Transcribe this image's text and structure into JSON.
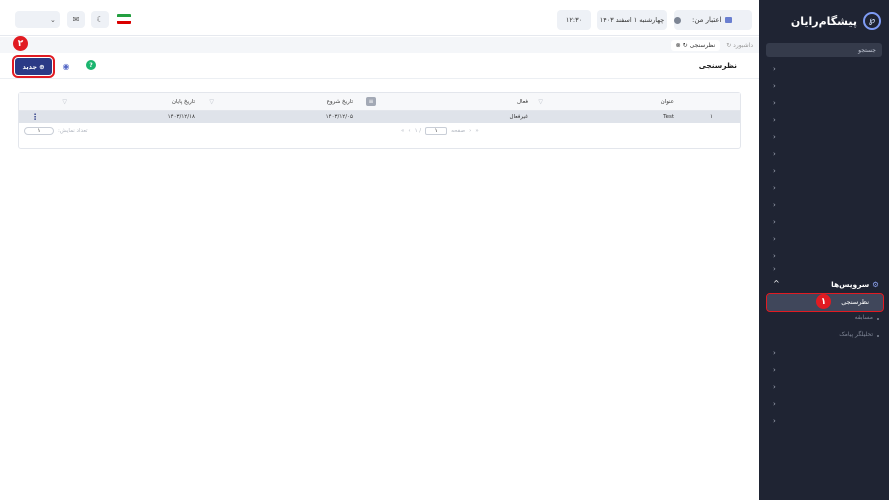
{
  "header": {
    "credit_label": "اعتبار من:",
    "date": "چهارشنبه ۱ اسفند ۱۴۰۳",
    "time": "۱۲:۳۰",
    "icons": [
      "flag-iran-icon",
      "moon-icon",
      "mail-icon",
      "chevron-down-icon"
    ]
  },
  "breadcrumbs": [
    {
      "label": "داشبورد"
    },
    {
      "label": "نظرسنجی"
    }
  ],
  "page": {
    "title": "نظرسنجی",
    "new_button": "جدید",
    "new_marker": "۲"
  },
  "table": {
    "columns": [
      "عنوان",
      "فعال",
      "تاریخ شروع",
      "تاریخ پایان"
    ],
    "rows": [
      {
        "index": "۱",
        "title": "Test",
        "active": "غیرفعال",
        "start": "۱۴۰۳/۱۲/۰۵",
        "end": "۱۴۰۳/۱۲/۱۸"
      }
    ],
    "pager": {
      "page_label": "صفحه",
      "page": "۱",
      "of": "/ ۱",
      "count_label": "تعداد نمایش:",
      "count": "۱"
    }
  },
  "sidebar": {
    "brand": "پیشگام‌رایان",
    "search_placeholder": "جستجو",
    "section_label": "سرویس‌ها",
    "active_item": "نظرسنجی",
    "active_marker": "۱",
    "sub_items": [
      "مسابقه",
      "تحلیلگر پیامک"
    ]
  },
  "colors": {
    "sidebar_bg": "#1f2433",
    "primary": "#2b3a86",
    "marker": "#e11b22",
    "help": "#1bb56f"
  }
}
